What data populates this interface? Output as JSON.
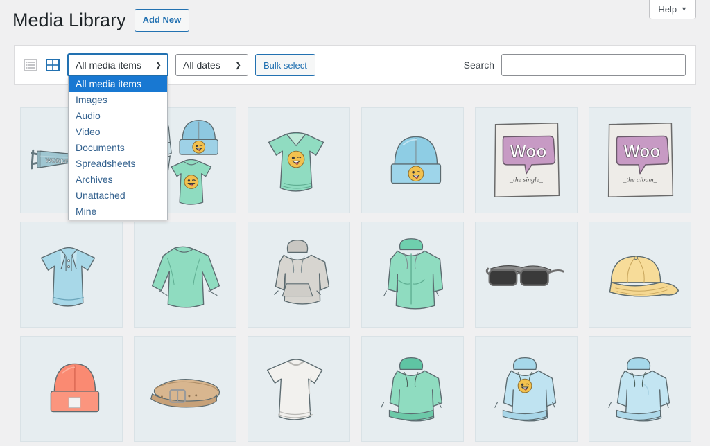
{
  "help": {
    "label": "Help",
    "caret": "▼",
    "icon": "chevron-down-icon"
  },
  "header": {
    "title": "Media Library",
    "add_new_label": "Add New"
  },
  "toolbar": {
    "view_list_icon": "list-view-icon",
    "view_grid_icon": "grid-view-icon",
    "media_type": {
      "selected": "All media items",
      "caret": "⌄",
      "options": [
        "All media items",
        "Images",
        "Audio",
        "Video",
        "Documents",
        "Spreadsheets",
        "Archives",
        "Unattached",
        "Mine"
      ],
      "open": true
    },
    "dates": {
      "selected": "All dates",
      "caret": "⌄",
      "options": [
        "All dates"
      ]
    },
    "bulk_select_label": "Bulk select",
    "search_label": "Search",
    "search_value": "",
    "search_placeholder": ""
  },
  "colors": {
    "accent": "#2271b1",
    "highlight": "#1878d2",
    "page_bg": "#f0f0f1",
    "tile_bg": "#e6edf0",
    "panel_bg": "#ffffff"
  },
  "grid": {
    "columns": 6,
    "items": [
      {
        "name": "wordpress-pennant-flag",
        "type": "image"
      },
      {
        "name": "beanie-and-tshirt-group",
        "type": "image"
      },
      {
        "name": "green-vneck-tshirt-emoji",
        "type": "image"
      },
      {
        "name": "blue-beanie-emoji",
        "type": "image"
      },
      {
        "name": "woo-the-single-album-cover",
        "type": "image",
        "caption_line1": "Woo",
        "caption_line2": "_the  single_"
      },
      {
        "name": "woo-the-album-album-cover",
        "type": "image",
        "caption_line1": "Woo",
        "caption_line2": "_the  album_"
      },
      {
        "name": "blue-polo-shirt",
        "type": "image"
      },
      {
        "name": "green-longsleeve-tee",
        "type": "image"
      },
      {
        "name": "grey-pullover-hoodie",
        "type": "image"
      },
      {
        "name": "green-zip-hoodie",
        "type": "image"
      },
      {
        "name": "black-sunglasses",
        "type": "image"
      },
      {
        "name": "yellow-baseball-cap",
        "type": "image"
      },
      {
        "name": "orange-beanie",
        "type": "image"
      },
      {
        "name": "tan-leather-belt",
        "type": "image"
      },
      {
        "name": "white-tshirt",
        "type": "image"
      },
      {
        "name": "green-pullover-hoodie",
        "type": "image"
      },
      {
        "name": "blue-hoodie-emoji",
        "type": "image"
      },
      {
        "name": "blue-pullover-hoodie",
        "type": "image"
      }
    ]
  }
}
